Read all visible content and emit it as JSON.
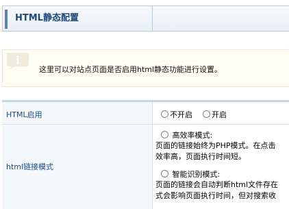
{
  "header": {
    "title": "HTML静态配置"
  },
  "notice": {
    "icon": "info-icon",
    "text": "这里可以对站点页面是否启用html静态功能进行设置。"
  },
  "settings": {
    "html_enable": {
      "label": "HTML启用",
      "options": [
        "不开启",
        "开启"
      ],
      "selected": null
    },
    "link_mode": {
      "label": "html链接模式",
      "options": [
        {
          "label": "高效率模式:",
          "desc_line1": "页面的链接始终为PHP模式。在点击",
          "desc_line2": "效率高，页面执行时间短。"
        },
        {
          "label": "智能识别模式:",
          "desc_line1": "页面的链接会自动判断html文件存在",
          "desc_line2": "式会影响页面执行时间，但对搜索收"
        }
      ],
      "selected": null
    }
  },
  "colors": {
    "title": "#1e4979",
    "accent": "#5a82b4",
    "label": "#1a4a8a",
    "notice_bg": "#fdfdf1"
  }
}
